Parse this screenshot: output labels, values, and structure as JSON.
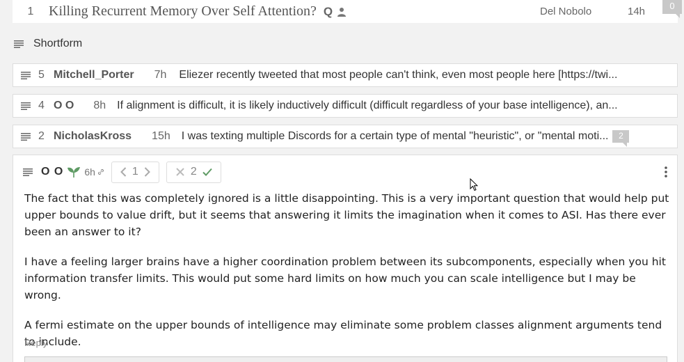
{
  "post": {
    "karma": "1",
    "title": "Killing Recurrent Memory Over Self Attention?",
    "question_marker": "Q",
    "author": "Del Nobolo",
    "age": "14h",
    "comment_count": "0"
  },
  "shortform": {
    "heading": "Shortform",
    "items": [
      {
        "karma": "5",
        "author": "Mitchell_Porter",
        "age": "7h",
        "text": "Eliezer recently tweeted that most people can't think, even most people here [https://twi..."
      },
      {
        "karma": "4",
        "author": "O O",
        "age": "8h",
        "text": "If alignment is difficult, it is likely inductively difficult (difficult regardless of your base intelligence), an..."
      },
      {
        "karma": "2",
        "author": "NicholasKross",
        "age": "15h",
        "text": "I was texting multiple Discords for a certain type of mental \"heuristic\", or \"mental moti...",
        "comments": "2"
      }
    ]
  },
  "comment": {
    "author": "O O",
    "age": "6h",
    "karma": "1",
    "agreement": "2",
    "paragraphs": [
      "The fact that this was completely ignored is a little disappointing. This is a very important question that would help put upper bounds to value drift, but it seems that answering it limits the imagination when it comes to ASI. Has there ever been an answer to it?",
      "I have a feeling larger brains have a higher coordination problem between its subcomponents, especially when you hit information transfer limits. This would put some hard limits on how much you can scale intelligence but I may be wrong.",
      "A fermi estimate on the upper bounds of intelligence may eliminate some problem classes alignment arguments tend to include."
    ],
    "reply_label": "Reply"
  },
  "icons": {
    "list": "list-icon",
    "sprout": "sprout-icon",
    "link": "link-icon",
    "person": "person-icon",
    "more": "kebab-menu-icon"
  },
  "colors": {
    "sprout": "#5f9b65",
    "agree_check": "#5f9b65",
    "badge": "#c8c8c8"
  }
}
